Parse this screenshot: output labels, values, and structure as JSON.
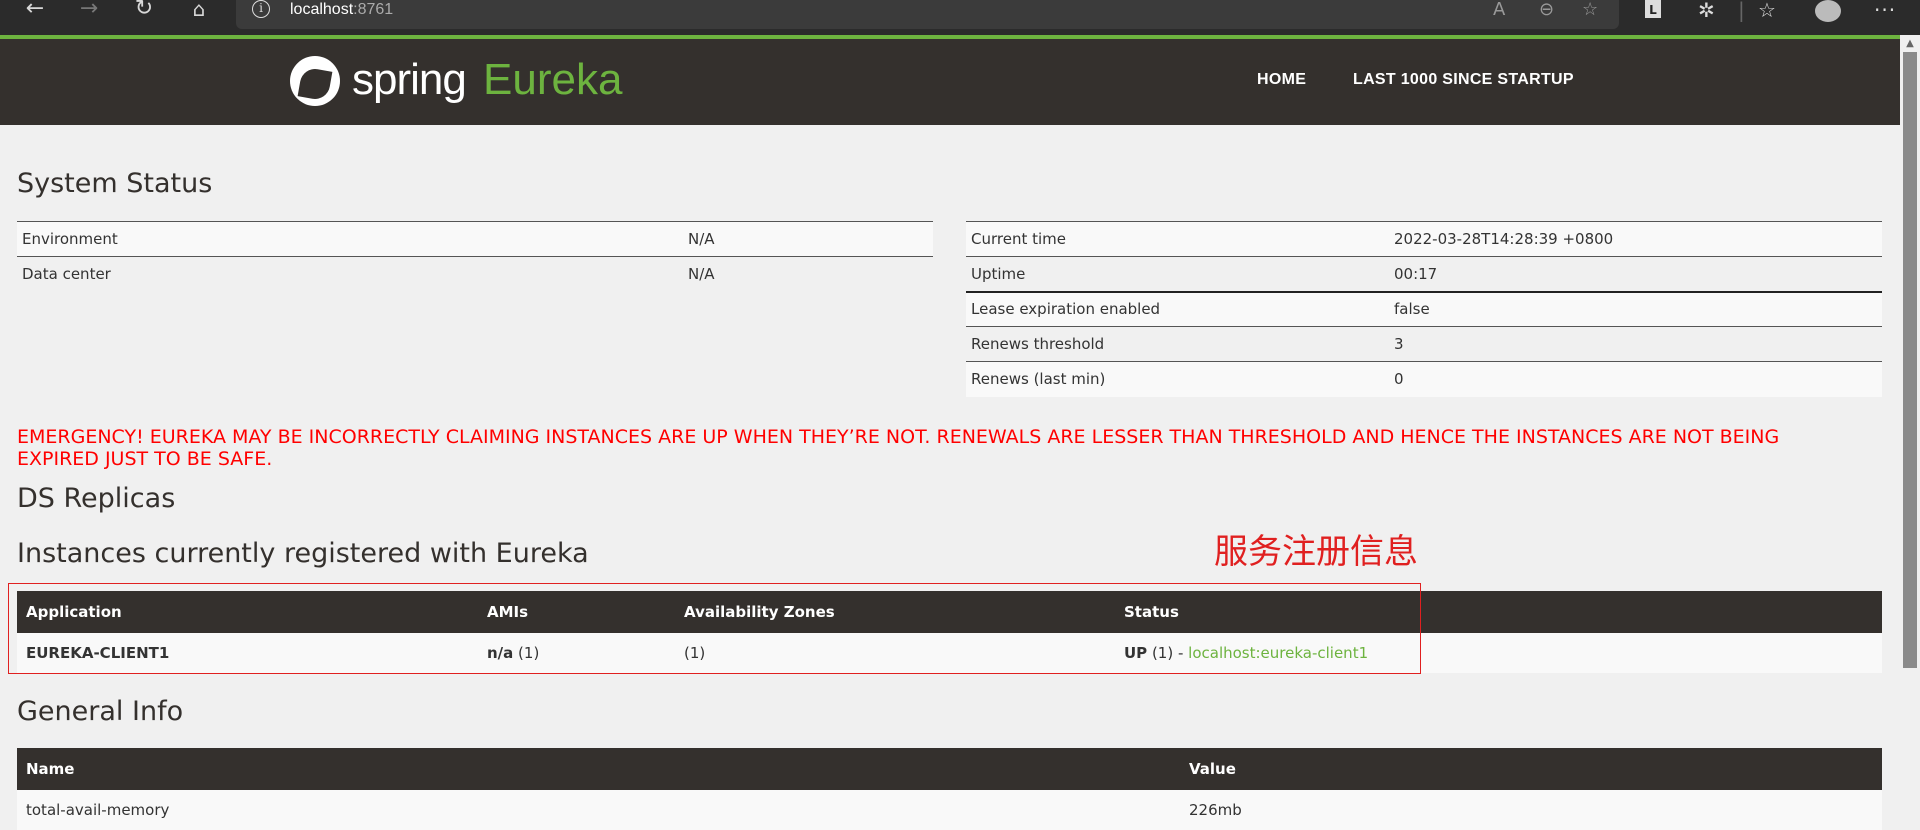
{
  "browser": {
    "url_host": "localhost",
    "url_port": ":8761",
    "icons": [
      "back-icon",
      "forward-icon",
      "refresh-icon",
      "home-icon",
      "info-icon",
      "read-aloud-icon",
      "zoom-out-icon",
      "add-favorite-icon",
      "extension-l-icon",
      "extensions-icon",
      "favorites-icon",
      "profile-icon",
      "more-icon"
    ]
  },
  "eureka_nav": {
    "logo_spring": "spring",
    "logo_eureka": "Eureka",
    "home": "HOME",
    "last1000": "LAST 1000 SINCE STARTUP"
  },
  "system_status": {
    "title": "System Status",
    "left": [
      {
        "key": "Environment",
        "value": "N/A"
      },
      {
        "key": "Data center",
        "value": "N/A"
      }
    ],
    "right": [
      {
        "key": "Current time",
        "value": "2022-03-28T14:28:39 +0800"
      },
      {
        "key": "Uptime",
        "value": "00:17"
      },
      {
        "key": "Lease expiration enabled",
        "value": "false"
      },
      {
        "key": "Renews threshold",
        "value": "3"
      },
      {
        "key": "Renews (last min)",
        "value": "0"
      }
    ]
  },
  "emergency": "EMERGENCY! EUREKA MAY BE INCORRECTLY CLAIMING INSTANCES ARE UP WHEN THEY’RE NOT. RENEWALS ARE LESSER THAN THRESHOLD AND HENCE THE INSTANCES ARE NOT BEING EXPIRED JUST TO BE SAFE.",
  "ds_replicas": {
    "title": "DS Replicas"
  },
  "instances": {
    "title": "Instances currently registered with Eureka",
    "annotation": "服务注册信息",
    "headers": [
      "Application",
      "AMIs",
      "Availability Zones",
      "Status"
    ],
    "rows": [
      {
        "application": "EUREKA-CLIENT1",
        "ami_bold": "n/a",
        "ami_count": " (1)",
        "zones": "(1)",
        "status_bold": "UP",
        "status_count": " (1) - ",
        "status_link": "localhost:eureka-client1"
      }
    ]
  },
  "general_info": {
    "title": "General Info",
    "headers": [
      "Name",
      "Value"
    ],
    "rows": [
      {
        "name": "total-avail-memory",
        "value": "226mb"
      }
    ]
  },
  "colors": {
    "spring_green": "#6db33f",
    "dark_bar": "#34302d",
    "emergency_red": "#ff0000",
    "annotation_red": "#e02020"
  }
}
